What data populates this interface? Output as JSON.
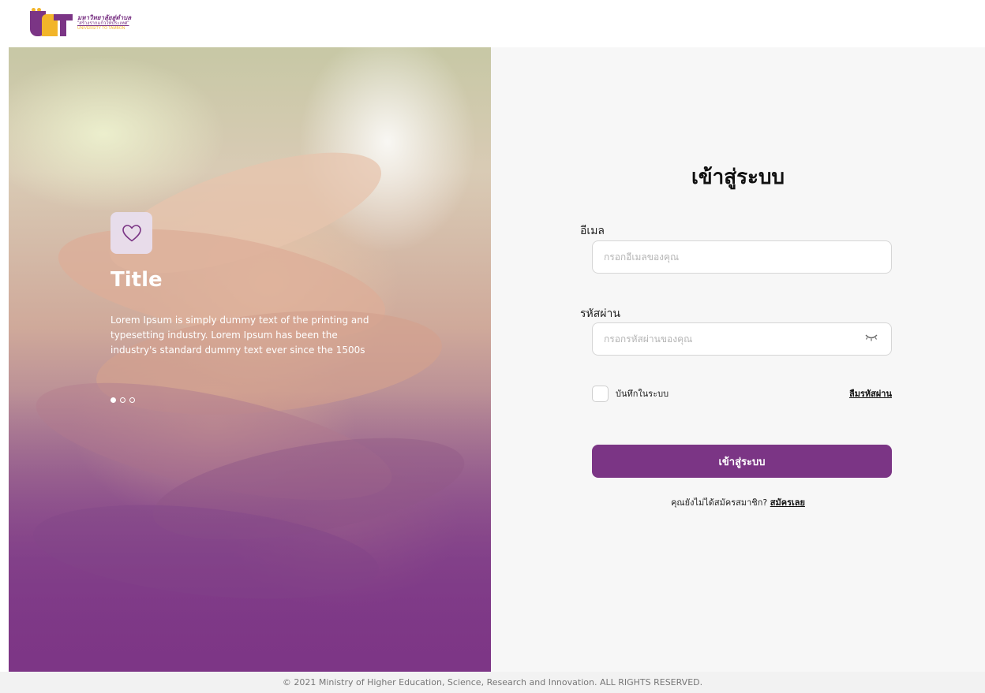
{
  "header": {
    "logo": {
      "mark": "U2T",
      "line1": "มหาวิทยาลัยสู่ตำบล",
      "line2": "\"สร้างรากแก้วให้ประเทศ\"",
      "line3": "UNIVERSITY TO TAMBON"
    }
  },
  "hero": {
    "icon": "heart-icon",
    "title": "Title",
    "description": "Lorem Ipsum is simply dummy text of the printing and typesetting industry. Lorem Ipsum has been the industry's standard dummy text ever since the 1500s",
    "slides": 3,
    "active_slide": 1
  },
  "login": {
    "title": "เข้าสู่ระบบ",
    "email_label": "อีเมล",
    "email_placeholder": "กรอกอีเมลของคุณ",
    "email_value": "",
    "password_label": "รหัสผ่าน",
    "password_placeholder": "กรอกรหัสผ่านของคุณ",
    "password_value": "",
    "remember_label": "บันทึกในระบบ",
    "forgot_label": "ลืมรหัสผ่าน",
    "submit_label": "เข้าสู่ระบบ",
    "signup_prompt": "คุณยังไม่ได้สมัครสมาชิก?",
    "signup_link": "สมัครเลย"
  },
  "footer": {
    "copyright": "© 2021 Ministry of Higher Education, Science, Research and Innovation. ALL RIGHTS RESERVED."
  },
  "colors": {
    "brand_purple": "#7b3585",
    "brand_yellow": "#f2b52a",
    "form_bg": "#f7f7f7"
  }
}
